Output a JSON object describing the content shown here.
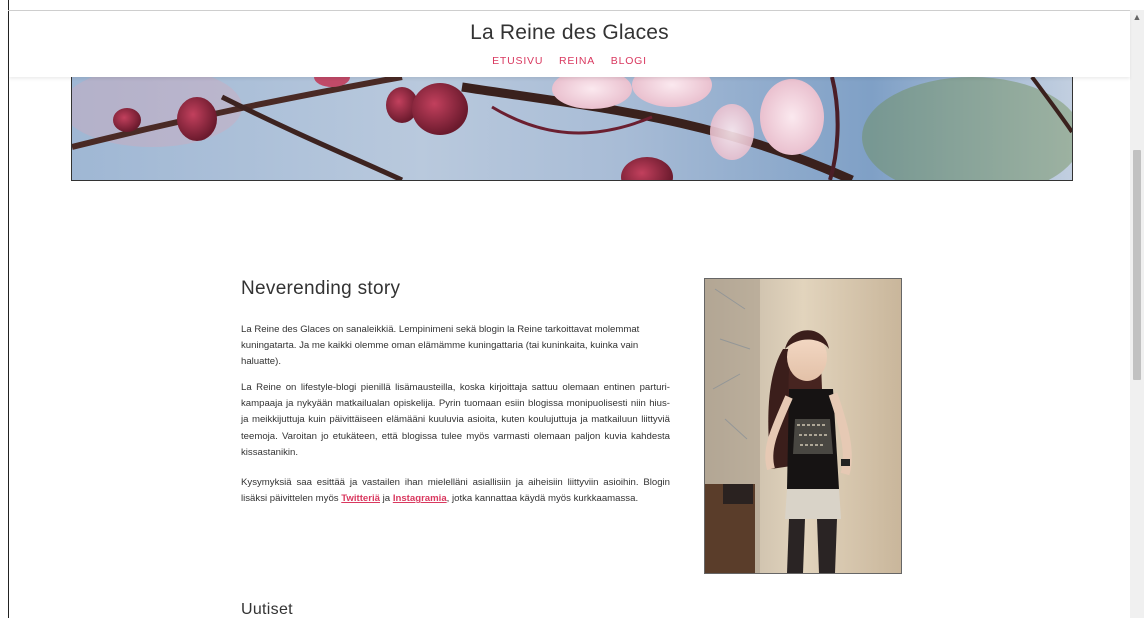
{
  "site": {
    "title": "La Reine des Glaces"
  },
  "nav": {
    "items": [
      "ETUSIVU",
      "REINA",
      "BLOGI"
    ]
  },
  "post": {
    "title": "Neverending story",
    "p1": "La Reine des Glaces on sanaleikkiä. Lempinimeni sekä blogin la Reine tarkoittavat molemmat kuningatarta. Ja me kaikki olemme oman elämämme kuningattaria (tai kuninkaita, kuinka vain haluatte).",
    "p2": "La Reine on lifestyle-blogi pienillä lisämausteilla, koska kirjoittaja sattuu olemaan entinen parturi-kampaaja ja nykyään matkailualan opiskelija. Pyrin tuomaan esiin blogissa monipuolisesti niin hius- ja meikkijuttuja kuin päivittäiseen elämääni kuuluvia asioita, kuten koulujuttuja ja matkailuun liittyviä teemoja. Varoitan jo etukäteen, että blogissa tulee myös varmasti olemaan paljon kuvia kahdesta kissastanikin.",
    "p3_before": "Kysymyksiä saa esittää ja vastailen ihan mielelläni asiallisiin ja aiheisiin liittyviin asioihin. Blogin lisäksi päivittelen myös ",
    "link_twitter": "Twitteriä",
    "p3_middle": " ja ",
    "link_instagram": "Instagramia",
    "p3_after": ", jotka kannattaa käydä myös kurkkaamassa."
  },
  "sections": {
    "news_title": "Uutiset"
  },
  "colors": {
    "accent": "#d9385f",
    "text": "#333333"
  }
}
